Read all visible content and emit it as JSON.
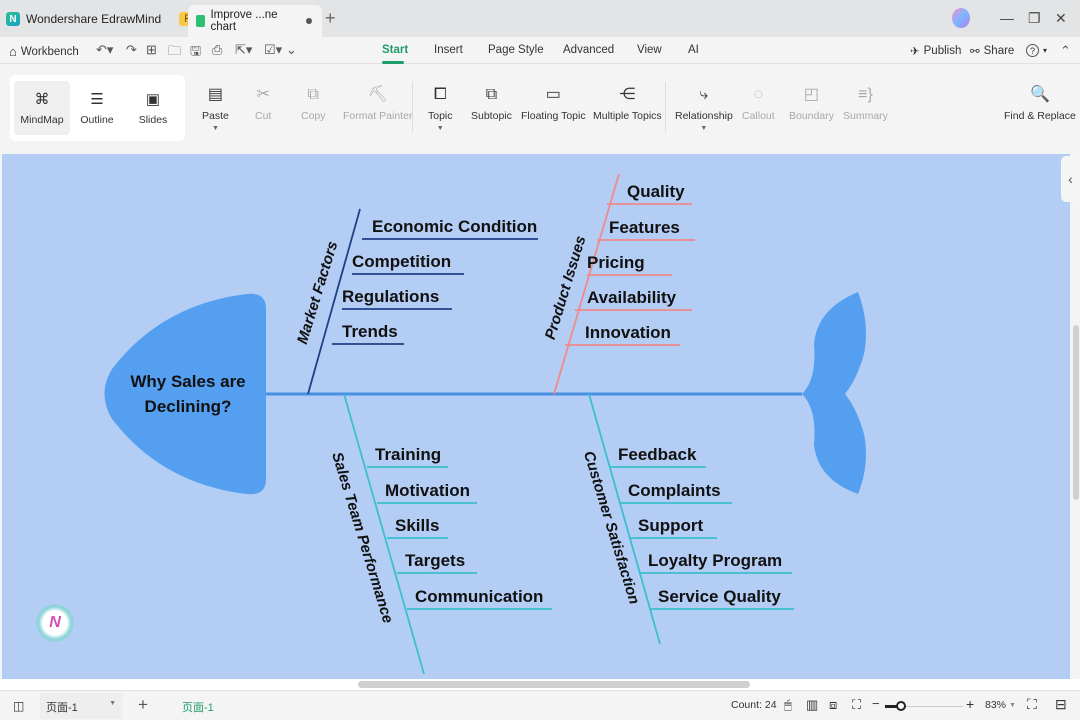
{
  "titlebar": {
    "app_name": "Wondershare EdrawMind",
    "pro_badge": "Pro",
    "doc_tab": "Improve ...ne chart",
    "new_tab_icon": "+",
    "minimize": "—",
    "restore": "❐",
    "close": "✕"
  },
  "menubar": {
    "workbench": "Workbench",
    "tabs": [
      "Start",
      "Insert",
      "Page Style",
      "Advanced",
      "View",
      "AI"
    ],
    "active_tab": "Start",
    "publish": "Publish",
    "share": "Share",
    "help": "?"
  },
  "ribbon": {
    "views": [
      {
        "label": "MindMap",
        "icon": "mindmap-icon",
        "glyph": "⌘"
      },
      {
        "label": "Outline",
        "icon": "outline-icon",
        "glyph": "☰"
      },
      {
        "label": "Slides",
        "icon": "slides-icon",
        "glyph": "▣"
      }
    ],
    "clipboard": [
      {
        "label": "Paste",
        "glyph": "📋",
        "enabled": true
      },
      {
        "label": "Cut",
        "glyph": "✂",
        "enabled": false
      },
      {
        "label": "Copy",
        "glyph": "⧉",
        "enabled": false
      },
      {
        "label": "Format Painter",
        "glyph": "🖌",
        "enabled": false
      }
    ],
    "insert": [
      {
        "label": "Topic",
        "glyph": "⧠"
      },
      {
        "label": "Subtopic",
        "glyph": "⧉"
      },
      {
        "label": "Floating Topic",
        "glyph": "▭"
      },
      {
        "label": "Multiple Topics",
        "glyph": "⋲"
      }
    ],
    "annotate": [
      {
        "label": "Relationship",
        "glyph": "⤷",
        "enabled": true
      },
      {
        "label": "Callout",
        "glyph": "💬",
        "enabled": false
      },
      {
        "label": "Boundary",
        "glyph": "◰",
        "enabled": false
      },
      {
        "label": "Summary",
        "glyph": "≡}",
        "enabled": false
      }
    ],
    "find_replace": "Find & Replace"
  },
  "diagram": {
    "head": "Why Sales are Declining?",
    "head_lines": [
      "Why Sales are",
      "Declining?"
    ],
    "colors": {
      "background": "#b3cdf4",
      "fish": "#559ff0",
      "spine": "#4a90e2",
      "market": "#1f3f86",
      "product": "#f08a8a",
      "sales": "#3bbfce",
      "customer": "#3bbfce"
    },
    "categories": [
      {
        "name": "Market Factors",
        "causes": [
          "Economic Condition",
          "Competition",
          "Regulations",
          "Trends"
        ]
      },
      {
        "name": "Product Issues",
        "causes": [
          "Quality",
          "Features",
          "Pricing",
          "Availability",
          "Innovation"
        ]
      },
      {
        "name": "Sales Team Performance",
        "causes": [
          "Training",
          "Motivation",
          "Skills",
          "Targets",
          "Communication"
        ]
      },
      {
        "name": "Customer Satisfaction",
        "causes": [
          "Feedback",
          "Complaints",
          "Support",
          "Loyalty Program",
          "Service Quality"
        ]
      }
    ]
  },
  "statusbar": {
    "page_select": "页面-1",
    "add_page": "+",
    "active_page": "页面-1",
    "count": "Count: 24",
    "zoom_minus": "−",
    "zoom_plus": "+",
    "zoom_level": "83%",
    "zoom_fraction": 0.2
  }
}
